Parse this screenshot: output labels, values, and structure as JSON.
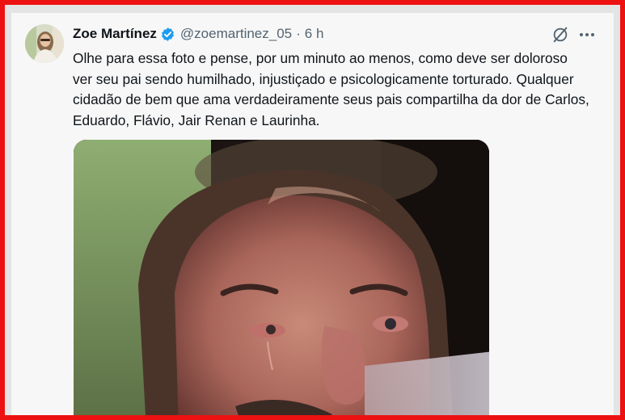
{
  "tweet": {
    "author_name": "Zoe Martínez",
    "handle": "@zoemartinez_05",
    "separator": "·",
    "time": "6 h",
    "text": "Olhe para essa foto e pense, por um minuto ao menos, como deve ser doloroso ver seu pai sendo humilhado, injustiçado e psicologicamente torturado. Qualquer cidadão de bem que ama verdadeiramente seus pais compartilha da dor de Carlos, Eduardo, Flávio, Jair Renan e Laurinha."
  },
  "icons": {
    "verified": "verified-badge-icon",
    "grok": "grok-icon",
    "more": "more-options-icon"
  },
  "colors": {
    "border": "#ee1111",
    "verified": "#1d9bf0",
    "text": "#0f1419",
    "secondary_text": "#536471",
    "background": "#f7f7f7"
  }
}
